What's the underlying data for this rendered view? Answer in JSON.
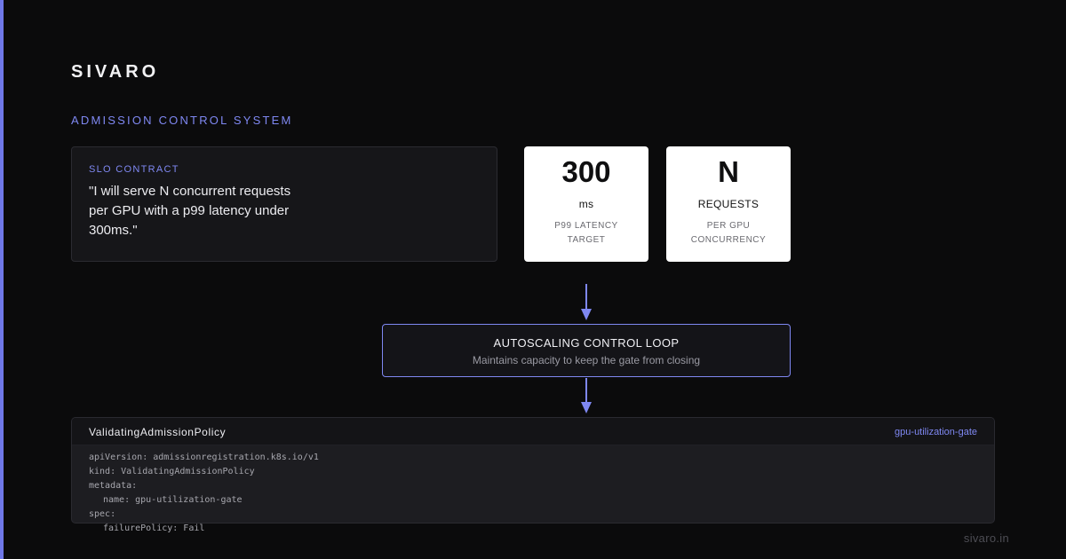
{
  "brand": "SIVARO",
  "section_label": "ADMISSION CONTROL SYSTEM",
  "slo": {
    "label": "SLO CONTRACT",
    "text": "\"I will serve N concurrent requests per GPU with a p99 latency under 300ms.\""
  },
  "metrics": [
    {
      "value": "300",
      "unit": "ms",
      "caption_lines": [
        "P99 LATENCY",
        "TARGET"
      ]
    },
    {
      "value": "N",
      "unit": "REQUESTS",
      "caption_lines": [
        "PER GPU",
        "CONCURRENCY"
      ]
    }
  ],
  "control_loop": {
    "title": "AUTOSCALING CONTROL LOOP",
    "subtitle": "Maintains capacity to keep the gate from closing"
  },
  "policy": {
    "title": "ValidatingAdmissionPolicy",
    "tag": "gpu-utilization-gate",
    "code_lines": [
      {
        "text": "apiVersion: admissionregistration.k8s.io/v1",
        "indent": 0
      },
      {
        "text": "kind: ValidatingAdmissionPolicy",
        "indent": 0
      },
      {
        "text": "metadata:",
        "indent": 0
      },
      {
        "text": "name: gpu-utilization-gate",
        "indent": 1
      },
      {
        "text": "spec:",
        "indent": 0
      },
      {
        "text": "failurePolicy: Fail",
        "indent": 1
      }
    ]
  },
  "footer": "sivaro.in",
  "colors": {
    "accent": "#7f88f2",
    "background": "#0b0b0c",
    "card_dark": "#161619",
    "card_light": "#ffffff"
  }
}
